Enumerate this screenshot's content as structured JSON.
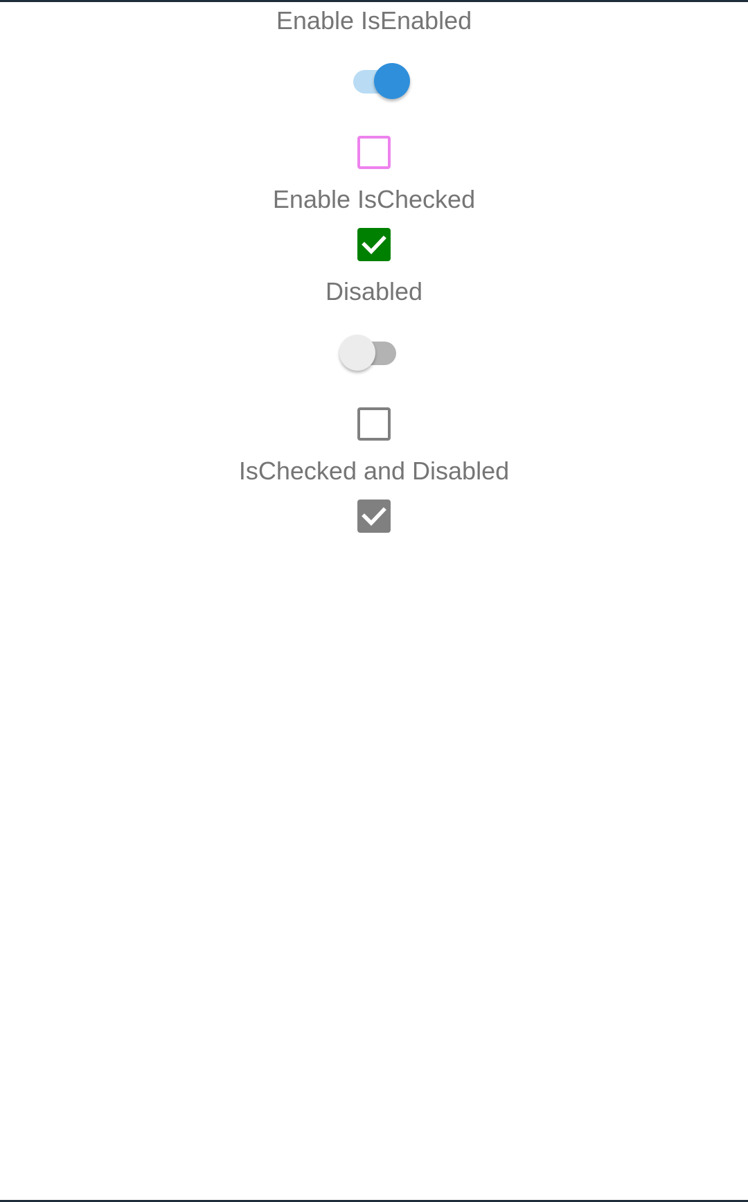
{
  "labels": {
    "enable_isenabled": "Enable IsEnabled",
    "enable_ischecked": "Enable IsChecked",
    "disabled": "Disabled",
    "ischecked_and_disabled": "IsChecked and Disabled"
  },
  "controls": {
    "isenabled_switch": {
      "state": "on",
      "track_color": "#b9dcf4",
      "thumb_color": "#2f8fdb"
    },
    "pink_checkbox": {
      "checked": false,
      "color": "#ee82ee"
    },
    "green_checkbox": {
      "checked": true,
      "color": "#008000"
    },
    "disabled_switch": {
      "state": "off",
      "track_color": "#b3b3b3",
      "thumb_color": "#ececec"
    },
    "disabled_checkbox": {
      "checked": false,
      "color": "#808080"
    },
    "checked_disabled_checkbox": {
      "checked": true,
      "color": "#808080"
    }
  },
  "icons": {
    "check": "checkmark-icon"
  },
  "colors": {
    "label_text": "#757575",
    "frame_bar": "#1f2d3a"
  }
}
